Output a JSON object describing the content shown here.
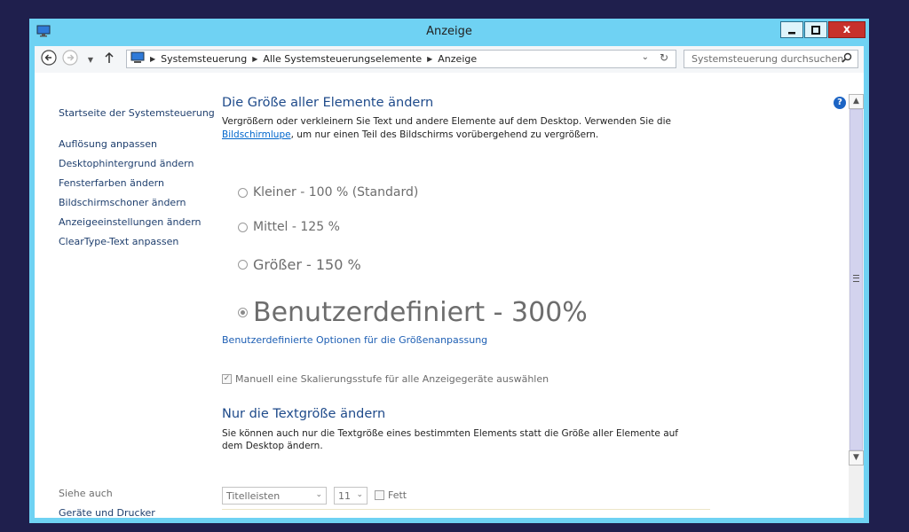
{
  "window": {
    "title": "Anzeige",
    "close_label": "x"
  },
  "nav": {
    "back_icon": "back-arrow-icon",
    "forward_icon": "forward-arrow-icon",
    "up_icon": "up-arrow-icon",
    "breadcrumbs": [
      "Systemsteuerung",
      "Alle Systemsteuerungselemente",
      "Anzeige"
    ]
  },
  "search": {
    "placeholder": "Systemsteuerung durchsuchen"
  },
  "sidebar": {
    "home": "Startseite der Systemsteuerung",
    "links": [
      "Auflösung anpassen",
      "Desktophintergrund ändern",
      "Fensterfarben ändern",
      "Bildschirmschoner ändern",
      "Anzeigeeinstellungen ändern",
      "ClearType-Text anpassen"
    ],
    "see_also": "Siehe auch",
    "devices": "Geräte und Drucker"
  },
  "main": {
    "heading": "Die Größe aller Elemente ändern",
    "description_before": "Vergrößern oder verkleinern Sie Text und andere Elemente auf dem Desktop. Verwenden Sie die",
    "description_link": "Bildschirmlupe",
    "description_after": ", um nur einen Teil des Bildschirms vorübergehend zu vergrößern.",
    "options": [
      {
        "label": "Kleiner - 100 % (Standard)",
        "selected": false
      },
      {
        "label": "Mittel - 125 %",
        "selected": false
      },
      {
        "label": "Größer - 150 %",
        "selected": false
      },
      {
        "label": "Benutzerdefiniert - 300%",
        "selected": true
      }
    ],
    "custom_options_link": "Benutzerdefinierte Optionen für die Größenanpassung",
    "checkbox_label": "Manuell eine Skalierungsstufe für alle Anzeigegeräte auswählen",
    "checkbox_checked": true,
    "heading2": "Nur die Textgröße ändern",
    "description2": "Sie können auch nur die Textgröße eines bestimmten Elements statt die Größe aller Elemente auf dem Desktop ändern.",
    "element_select": "Titelleisten",
    "size_select": "11",
    "bold_label": "Fett",
    "bold_checked": false
  },
  "colors": {
    "titlebar": "#6fd2f3",
    "accent_text": "#1e4a8a",
    "link": "#1e5fb4",
    "close": "#c7312b",
    "desktop": "#1f1f4d"
  }
}
